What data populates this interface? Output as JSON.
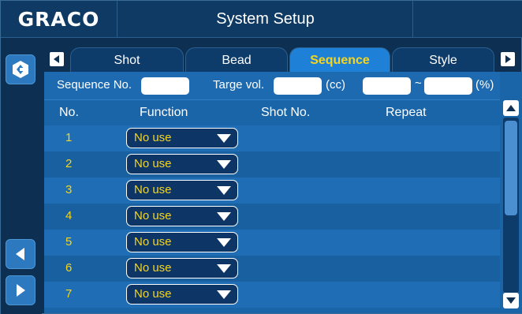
{
  "header": {
    "logo": "GRACO",
    "title": "System Setup"
  },
  "tabs": [
    {
      "label": "Shot",
      "active": false
    },
    {
      "label": "Bead",
      "active": false
    },
    {
      "label": "Sequence",
      "active": true
    },
    {
      "label": "Style",
      "active": false
    }
  ],
  "params": {
    "sequence_no_label": "Sequence No.",
    "sequence_no_value": "",
    "target_vol_label": "Targe vol.",
    "target_vol_value": "",
    "target_vol_unit": "(cc)",
    "range_min_value": "",
    "range_sep": "~",
    "range_max_value": "",
    "range_unit": "(%)"
  },
  "columns": {
    "no": "No.",
    "function": "Function",
    "shot_no": "Shot No.",
    "repeat": "Repeat"
  },
  "rows": [
    {
      "no": "1",
      "function": "No use"
    },
    {
      "no": "2",
      "function": "No use"
    },
    {
      "no": "3",
      "function": "No use"
    },
    {
      "no": "4",
      "function": "No use"
    },
    {
      "no": "5",
      "function": "No use"
    },
    {
      "no": "6",
      "function": "No use"
    },
    {
      "no": "7",
      "function": "No use"
    }
  ],
  "icons": {
    "home": "graco-home-icon",
    "prev_page": "left-arrow-icon",
    "next_page": "right-arrow-icon",
    "tab_prev": "tab-left-arrow-icon",
    "tab_next": "tab-right-arrow-icon",
    "scroll_up": "scroll-up-icon",
    "scroll_down": "scroll-down-icon"
  },
  "colors": {
    "background": "#0c2f52",
    "accent_yellow": "#f6d51c",
    "active_tab": "#1f80d8",
    "button_blue": "#2d79c0"
  }
}
